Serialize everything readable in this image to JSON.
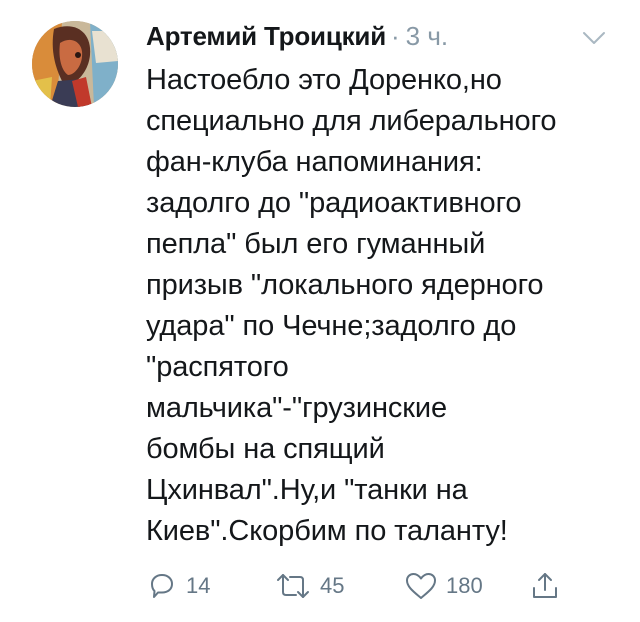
{
  "tweet": {
    "author_name": "Артемий Троицкий",
    "separator": "·",
    "timestamp": "3 ч.",
    "text": "Настоебло это Доренко,но\nспециально для либерального\nфан-клуба напоминания:\nзадолго до \"радиоактивного\nпепла\" был его гуманный\nпризыв \"локального ядерного\nудара\" по Чечне;задолго до\n\"распятого\nмальчика\"-\"грузинские\nбомбы на спящий\nЦхинвал\".Ну,и \"танки на\nКиев\".Скорбим по таланту!",
    "actions": {
      "reply_count": "14",
      "retweet_count": "45",
      "like_count": "180"
    }
  },
  "icons": {
    "avatar": "avatar-image",
    "menu": "chevron-down-icon",
    "reply": "reply-icon",
    "retweet": "retweet-icon",
    "like": "heart-icon",
    "share": "share-icon"
  },
  "colors": {
    "text": "#14171a",
    "secondary": "#8899a6",
    "icon": "#657786",
    "background": "#ffffff"
  }
}
